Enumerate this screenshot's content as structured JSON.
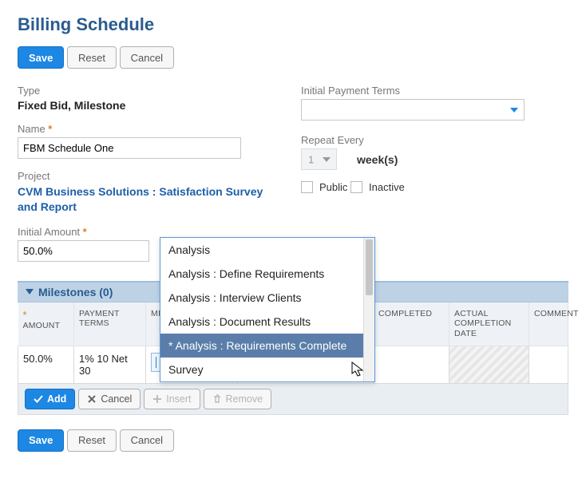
{
  "title": "Billing Schedule",
  "buttons": {
    "save": "Save",
    "reset": "Reset",
    "cancel": "Cancel"
  },
  "left": {
    "type_label": "Type",
    "type_value": "Fixed Bid, Milestone",
    "name_label": "Name",
    "name_value": "FBM Schedule One",
    "project_label": "Project",
    "project_value": "CVM Business Solutions : Satisfaction Survey and Report",
    "initial_amount_label": "Initial Amount",
    "initial_amount_value": "50.0%"
  },
  "right": {
    "ipt_label": "Initial Payment Terms",
    "ipt_value": "",
    "repeat_label": "Repeat Every",
    "repeat_value": "1",
    "weeks_text": "week(s)",
    "public_label": "Public",
    "inactive_label": "Inactive"
  },
  "milestones": {
    "header": "Milestones (0)",
    "columns": {
      "amount": "AMOUNT",
      "payment_terms": "PAYMENT TERMS",
      "milestone": "MILESTONE",
      "completed": "COMPLETED",
      "actual_date": "ACTUAL COMPLETION DATE",
      "comment": "COMMENT"
    },
    "row": {
      "amount": "50.0%",
      "payment_terms": "1% 10 Net 30",
      "milestone": ""
    },
    "row_buttons": {
      "add": "Add",
      "cancel": "Cancel",
      "insert": "Insert",
      "remove": "Remove"
    }
  },
  "dropdown": {
    "items": [
      "Analysis",
      "Analysis : Define Requirements",
      "Analysis : Interview Clients",
      "Analysis : Document Results",
      "* Analysis : Requirements Complete",
      "Survey"
    ],
    "selected_index": 4
  }
}
